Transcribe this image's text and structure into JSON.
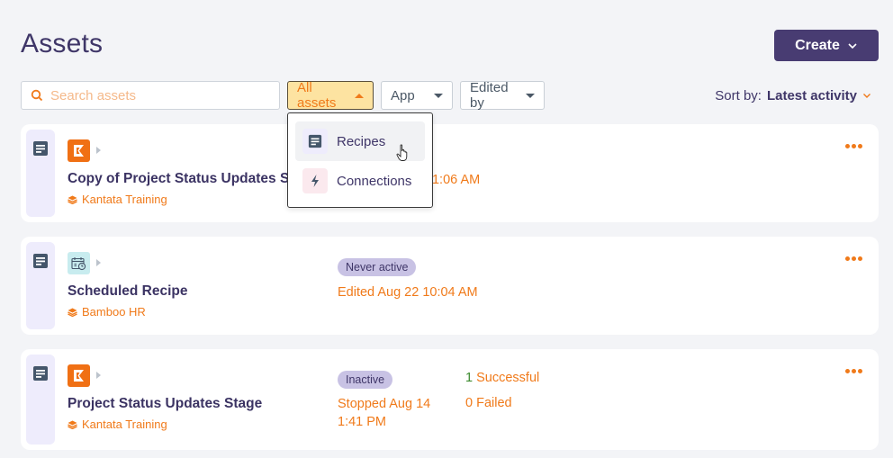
{
  "page": {
    "title": "Assets"
  },
  "header": {
    "create_label": "Create"
  },
  "toolbar": {
    "search_placeholder": "Search assets",
    "search_value": "",
    "filters": [
      {
        "label": "All assets",
        "state": "open"
      },
      {
        "label": "App"
      },
      {
        "label": "Edited by"
      }
    ],
    "sort_prefix": "Sort by:",
    "sort_value": "Latest activity"
  },
  "dropdown": {
    "items": [
      {
        "label": "Recipes",
        "icon": "recipe-doc-icon"
      },
      {
        "label": "Connections",
        "icon": "lightning-icon"
      }
    ]
  },
  "assets": [
    {
      "name": "Copy of Project Status Updates Stag",
      "app": "Kantata",
      "connection": "Kantata Training",
      "date": "11:06 AM"
    },
    {
      "name": "Scheduled Recipe",
      "app": "Scheduler",
      "connection": "Bamboo HR",
      "status": "Never active",
      "date": "Edited Aug 22 10:04 AM"
    },
    {
      "name": "Project Status Updates Stage",
      "app": "Kantata",
      "connection": "Kantata Training",
      "status": "Inactive",
      "date_line1": "Stopped Aug 14",
      "date_line2": "1:41 PM",
      "successful_count": "1",
      "successful_label": "Successful",
      "failed": "0 Failed"
    }
  ],
  "colors": {
    "accent": "#f07a1a",
    "primary": "#483c72",
    "badge": "#c8c2e4",
    "success": "#3c8a2e"
  }
}
